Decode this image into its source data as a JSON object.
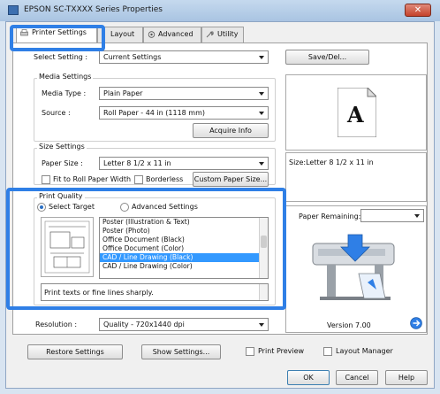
{
  "window": {
    "title": "EPSON SC-TXXXX Series Properties"
  },
  "tabs": [
    {
      "label": "Printer Settings"
    },
    {
      "label": "Layout"
    },
    {
      "label": "Advanced"
    },
    {
      "label": "Utility"
    }
  ],
  "select_setting": {
    "label": "Select Setting :",
    "value": "Current Settings",
    "button": "Save/Del..."
  },
  "media_settings": {
    "title": "Media Settings",
    "media_type_label": "Media Type :",
    "media_type_value": "Plain Paper",
    "source_label": "Source :",
    "source_value": "Roll Paper - 44 in (1118 mm)",
    "acquire_button": "Acquire Info"
  },
  "preview": {
    "glyph": "A",
    "size_text": "Size:Letter 8 1/2 x 11 in"
  },
  "size_settings": {
    "title": "Size Settings",
    "paper_size_label": "Paper Size :",
    "paper_size_value": "Letter 8 1/2 x 11 in",
    "fit_roll_label": "Fit to Roll Paper Width",
    "borderless_label": "Borderless",
    "custom_button": "Custom Paper Size..."
  },
  "print_quality": {
    "title": "Print Quality",
    "select_target_label": "Select Target",
    "advanced_label": "Advanced Settings",
    "targets": [
      "Poster (Illustration & Text)",
      "Poster (Photo)",
      "Office Document (Black)",
      "Office Document (Color)",
      "CAD / Line Drawing (Black)",
      "CAD / Line Drawing (Color)"
    ],
    "selected_index": 4,
    "description": "Print texts or fine lines sharply."
  },
  "paper_remaining": {
    "label": "Paper Remaining:"
  },
  "resolution": {
    "label": "Resolution :",
    "value": "Quality - 720x1440 dpi"
  },
  "version": {
    "text": "Version 7.00"
  },
  "bottom": {
    "restore_button": "Restore Settings",
    "show_button": "Show Settings...",
    "print_preview_label": "Print Preview",
    "layout_manager_label": "Layout Manager"
  },
  "dialog_buttons": {
    "ok": "OK",
    "cancel": "Cancel",
    "help": "Help"
  },
  "colors": {
    "highlight": "#2f7fe6",
    "selection": "#3399ff",
    "close": "#c4422b"
  }
}
